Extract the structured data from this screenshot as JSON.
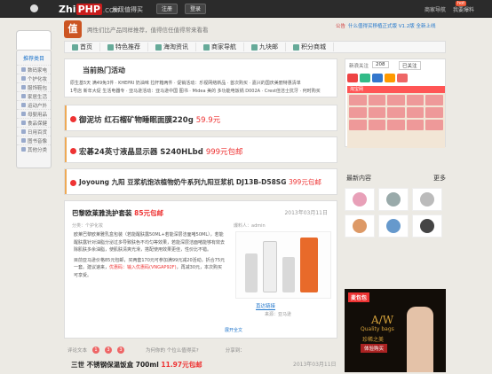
{
  "topbar": {
    "logo_a": "Zhi",
    "logo_b": "PHP",
    "logo_c": ".COM",
    "link": "发现值得买",
    "register": "注册",
    "login": "登录",
    "right_a": "商家导航",
    "right_b": "我要爆料",
    "hot": "hot"
  },
  "sidebar": {
    "title": "推荐类目",
    "items": [
      "数码家电",
      "个护化妆",
      "服饰鞋包",
      "家居生活",
      "运动户外",
      "母婴用品",
      "食品保健",
      "日用百货",
      "图书音像",
      "其他分类"
    ]
  },
  "header": {
    "mark": "值",
    "slogan": "两性们比产品同样推荐，值得信任值得常来看看",
    "ann_tag": "公告",
    "ann_text": "什么值得买移植正式版 V1.2版 全新上线"
  },
  "nav": {
    "items": [
      "首页",
      "特色推荐",
      "海淘资讯",
      "商家导航",
      "九块邮",
      "积分商城"
    ]
  },
  "hot": {
    "title": "当前热门活动",
    "rows": [
      "原生基5天 满49免3件 · KHEPRI 奶油味 拉杆箱两件 · 促销活动：乐视网络新品 · 首次购买 · 嘉兴的国庆美丽特惠清单",
      "1号店 新年大促 生活电器专 · 亚马逊活动：亚马逊中国 图书 · Midea 美的 多功能电饭锅 D002A · Crest佳洁士抗牙 · 何时购买"
    ]
  },
  "promos": [
    {
      "text": "御泥坊 红石榴矿物睡眠面膜220g",
      "price": "59.9元"
    },
    {
      "text": "宏碁24英寸液晶显示器 S240HLbd",
      "price": "999元包邮"
    },
    {
      "text": "Joyoung 九阳 豆浆机饱浓植物奶牛系列九阳豆浆机 DJ13B-D58SG",
      "price": "399元包邮"
    }
  ],
  "article": {
    "title": "巴黎欧莱雅洗护套装",
    "price": "85元包邮",
    "date": "2013年03月11日",
    "meta": "分类：个护化妆",
    "author": "爆料人：admin",
    "body_a": "欧莱巴黎欧莱雅乳盒包装（若能醒肤露50ML+若能深层洁面啫50ML），若能醒肤露针对油脂分泌过多导致肤色不均匀等效果，若能深层洁面啫能够有效去除肌肤多余油脂，使肌肤清爽光滑，搭配使用效果更佳，性价比不错。",
    "body_b": "目前亚马逊价格85元包邮，买两套170元可参加满99元减20活动，折合75元一套。建议速来，",
    "body_red": "优惠码：输入优惠码(VNGAP92F)",
    "body_c": "，再减30元，本次购买可享受。",
    "buy": "直达链接",
    "shop": "来源：亚马逊",
    "more": "展开全文"
  },
  "article_foot": {
    "comment": "评论文本",
    "c1": "1",
    "c2": "3",
    "c3": "3",
    "question": "为何你的 个位么值得买?",
    "share": "分享到："
  },
  "next": {
    "title": "三世 不锈钢保温饭盒 700ml",
    "price": "11.97元包邮",
    "date": "2013年03月11日"
  },
  "right": {
    "follow": "新浪关注",
    "count": "208",
    "link": "已关注",
    "taobao": "淘宝网",
    "section": "最新内容",
    "more": "更多"
  },
  "ad": {
    "badge": "麦包包",
    "t1": "A/W",
    "t2": "Quality bags",
    "t3": "珍稀之美",
    "btn": "体验购买"
  }
}
